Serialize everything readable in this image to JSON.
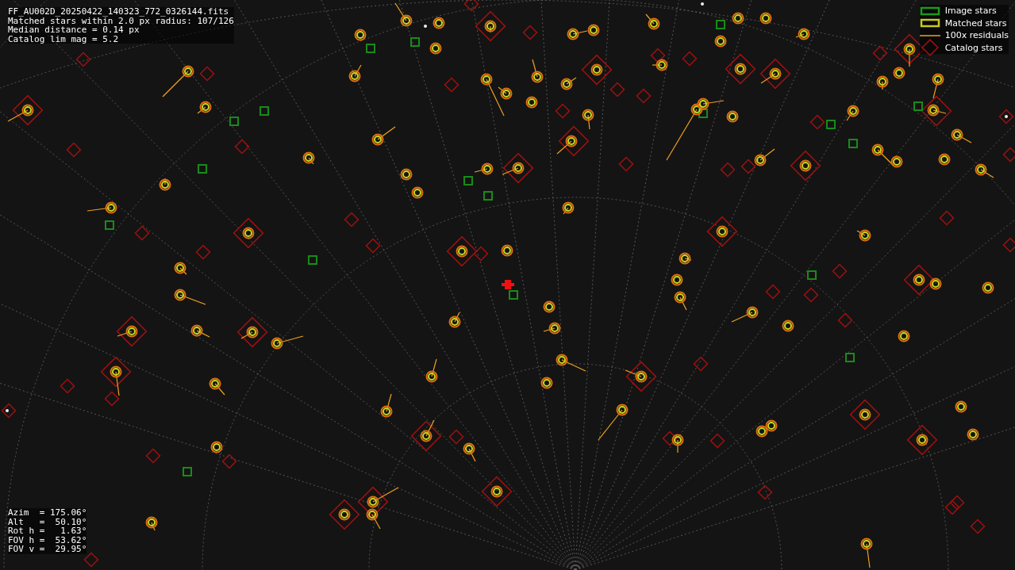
{
  "header": {
    "lines": [
      "FF_AU002D_20250422_140323_772_0326144.fits",
      "Matched stars within 2.0 px radius: 107/126",
      "Median distance = 0.14 px",
      "Catalog lim mag = 5.2"
    ]
  },
  "legend": [
    {
      "kind": "image",
      "label": "Image stars"
    },
    {
      "kind": "matched",
      "label": "Matched stars"
    },
    {
      "kind": "residual",
      "label": "100x residuals"
    },
    {
      "kind": "catalog",
      "label": "Catalog stars"
    }
  ],
  "pointing": {
    "lines": [
      "Azim  = 175.06°",
      "Alt   =  50.10°",
      "Rot h =   1.63°",
      "FOV h =  53.62°",
      "FOV v =  29.95°"
    ]
  }
}
